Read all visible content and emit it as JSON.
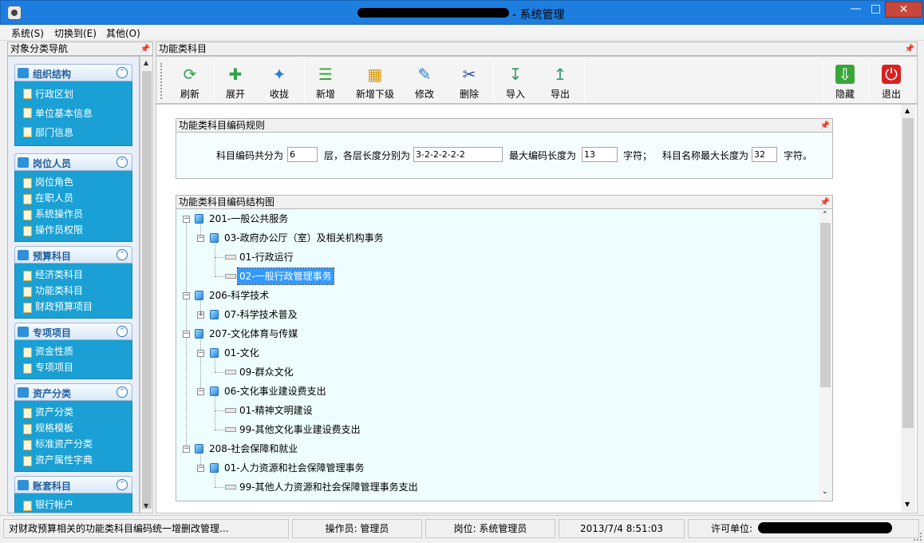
{
  "window": {
    "title_suffix": "- 系统管理"
  },
  "menu": [
    "系统(S)",
    "切换到(E)",
    "其他(O)"
  ],
  "nav": {
    "header": "对象分类导航",
    "groups": [
      {
        "title": "组织结构",
        "items": [
          "行政区划",
          "单位基本信息",
          "部门信息"
        ]
      },
      {
        "title": "岗位人员",
        "items": [
          "岗位角色",
          "在职人员",
          "系统操作员",
          "操作员权限"
        ]
      },
      {
        "title": "预算科目",
        "items": [
          "经济类科目",
          "功能类科目",
          "财政预算项目"
        ]
      },
      {
        "title": "专项项目",
        "items": [
          "资金性质",
          "专项项目"
        ]
      },
      {
        "title": "资产分类",
        "items": [
          "资产分类",
          "规格模板",
          "标准资产分类",
          "资产属性字典"
        ]
      },
      {
        "title": "账套科目",
        "items": [
          "银行帐户"
        ]
      }
    ]
  },
  "main": {
    "header": "功能类科目",
    "toolbar": [
      {
        "label": "刷新",
        "icon": "refresh-icon"
      },
      {
        "label": "展开",
        "icon": "expand-icon"
      },
      {
        "label": "收拢",
        "icon": "collapse-icon"
      },
      {
        "label": "新增",
        "icon": "add-icon"
      },
      {
        "label": "新增下级",
        "icon": "add-child-icon"
      },
      {
        "label": "修改",
        "icon": "edit-icon"
      },
      {
        "label": "删除",
        "icon": "delete-icon"
      },
      {
        "label": "导入",
        "icon": "import-icon"
      },
      {
        "label": "导出",
        "icon": "export-icon"
      },
      {
        "label": "隐藏",
        "icon": "hide-icon"
      },
      {
        "label": "退出",
        "icon": "exit-icon"
      }
    ],
    "rules": {
      "title": "功能类科目编码规则",
      "levels_label": "科目编码共分为",
      "levels_value": "6",
      "lengths_label": "层，各层长度分别为",
      "lengths_value": "3-2-2-2-2-2",
      "maxlen_label": "最大编码长度为",
      "maxlen_value": "13",
      "unit1": "字符；",
      "namelen_label": "科目名称最大长度为",
      "namelen_value": "32",
      "unit2": "字符。"
    },
    "tree": {
      "title": "功能类科目编码结构图",
      "nodes": [
        {
          "label": "201-一般公共服务",
          "level": 0,
          "type": "branch",
          "expanded": true
        },
        {
          "label": "03-政府办公厅（室）及相关机构事务",
          "level": 1,
          "type": "branch",
          "expanded": true
        },
        {
          "label": "01-行政运行",
          "level": 2,
          "type": "leaf"
        },
        {
          "label": "02-一般行政管理事务",
          "level": 2,
          "type": "leaf",
          "selected": true
        },
        {
          "label": "206-科学技术",
          "level": 0,
          "type": "branch",
          "expanded": true
        },
        {
          "label": "07-科学技术普及",
          "level": 1,
          "type": "branch",
          "expanded": false
        },
        {
          "label": "207-文化体育与传媒",
          "level": 0,
          "type": "branch",
          "expanded": true
        },
        {
          "label": "01-文化",
          "level": 1,
          "type": "branch",
          "expanded": true
        },
        {
          "label": "09-群众文化",
          "level": 2,
          "type": "leaf"
        },
        {
          "label": "06-文化事业建设费支出",
          "level": 1,
          "type": "branch",
          "expanded": true
        },
        {
          "label": "01-精神文明建设",
          "level": 2,
          "type": "leaf"
        },
        {
          "label": "99-其他文化事业建设费支出",
          "level": 2,
          "type": "leaf"
        },
        {
          "label": "208-社会保障和就业",
          "level": 0,
          "type": "branch",
          "expanded": true
        },
        {
          "label": "01-人力资源和社会保障管理事务",
          "level": 1,
          "type": "branch",
          "expanded": true
        },
        {
          "label": "99-其他人力资源和社会保障管理事务支出",
          "level": 2,
          "type": "leaf"
        }
      ]
    }
  },
  "status": {
    "message": "对财政预算相关的功能类科目编码统一增删改管理...",
    "operator": "操作员: 管理员",
    "role": "岗位: 系统管理员",
    "datetime": "2013/7/4 8:51:03",
    "license": "许可单位:"
  },
  "colors": {
    "titlebar": "#1d7ee0",
    "nav_group_body": "#1aa0d4",
    "selection": "#3399ff",
    "tree_bg": "#eefdfd"
  }
}
